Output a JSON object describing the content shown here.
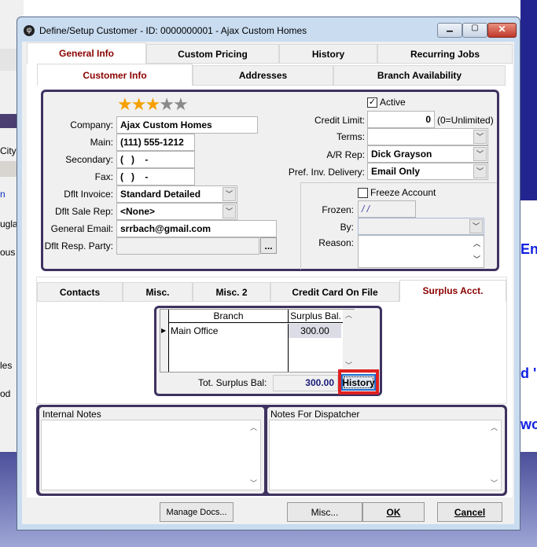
{
  "background": {
    "left_fragments": [
      "City",
      "n",
      "ugla",
      "ous",
      "les",
      "od"
    ],
    "right_fragments": [
      "Ent",
      "d '",
      "wo"
    ]
  },
  "window": {
    "title": "Define/Setup Customer - ID: 0000000001 - Ajax Custom Homes"
  },
  "main_tabs": [
    {
      "label": "General Info",
      "selected": true
    },
    {
      "label": "Custom Pricing"
    },
    {
      "label": "History"
    },
    {
      "label": "Recurring Jobs"
    }
  ],
  "sub_tabs": [
    {
      "label": "Customer Info",
      "selected": true
    },
    {
      "label": "Addresses"
    },
    {
      "label": "Branch Availability"
    }
  ],
  "rating": {
    "value": 3,
    "max": 5
  },
  "form": {
    "company": {
      "label": "Company:",
      "value": "Ajax Custom Homes"
    },
    "main": {
      "label": "Main:",
      "value": "(111) 555-1212"
    },
    "secondary": {
      "label": "Secondary:",
      "value": "(   )    -"
    },
    "fax": {
      "label": "Fax:",
      "value": "(   )    -"
    },
    "dflt_invoice": {
      "label": "Dflt Invoice:",
      "value": "Standard Detailed"
    },
    "dflt_sale_rep": {
      "label": "Dflt Sale Rep:",
      "value": "<None>"
    },
    "general_email": {
      "label": "General Email:",
      "value": "srrbach@gmail.com"
    },
    "dflt_resp_party": {
      "label": "Dflt Resp. Party:",
      "value": "",
      "button": "..."
    },
    "active": {
      "label": "Active",
      "checked": true
    },
    "credit_limit": {
      "label": "Credit Limit:",
      "value": "0",
      "note": "(0=Unlimited)"
    },
    "terms": {
      "label": "Terms:",
      "value": ""
    },
    "ar_rep": {
      "label": "A/R Rep:",
      "value": "Dick Grayson"
    },
    "pref_inv_delivery": {
      "label": "Pref. Inv. Delivery:",
      "value": "Email Only"
    },
    "freeze_account": {
      "label": "Freeze Account",
      "checked": false
    },
    "frozen": {
      "label": "Frozen:",
      "value": "/ /"
    },
    "by": {
      "label": "By:",
      "value": ""
    },
    "reason": {
      "label": "Reason:",
      "value": ""
    }
  },
  "lower_tabs": [
    {
      "label": "Contacts"
    },
    {
      "label": "Misc."
    },
    {
      "label": "Misc. 2"
    },
    {
      "label": "Credit Card On File"
    },
    {
      "label": "Surplus Acct.",
      "selected": true
    }
  ],
  "surplus": {
    "columns": [
      "Branch",
      "Surplus Bal."
    ],
    "rows": [
      {
        "branch": "Main Office",
        "balance": "300.00"
      }
    ],
    "total_label": "Tot. Surplus Bal:",
    "total": "300.00",
    "history_button": "History"
  },
  "notes": {
    "internal": "Internal Notes",
    "dispatcher": "Notes For Dispatcher"
  },
  "footer": {
    "manage_docs": "Manage Docs...",
    "misc": "Misc...",
    "ok": "OK",
    "cancel": "Cancel"
  },
  "colors": {
    "accent_tab": "#8b0000",
    "frame": "#3e3260",
    "highlight": "#e02020",
    "title_bar": "#c9dcf0"
  }
}
